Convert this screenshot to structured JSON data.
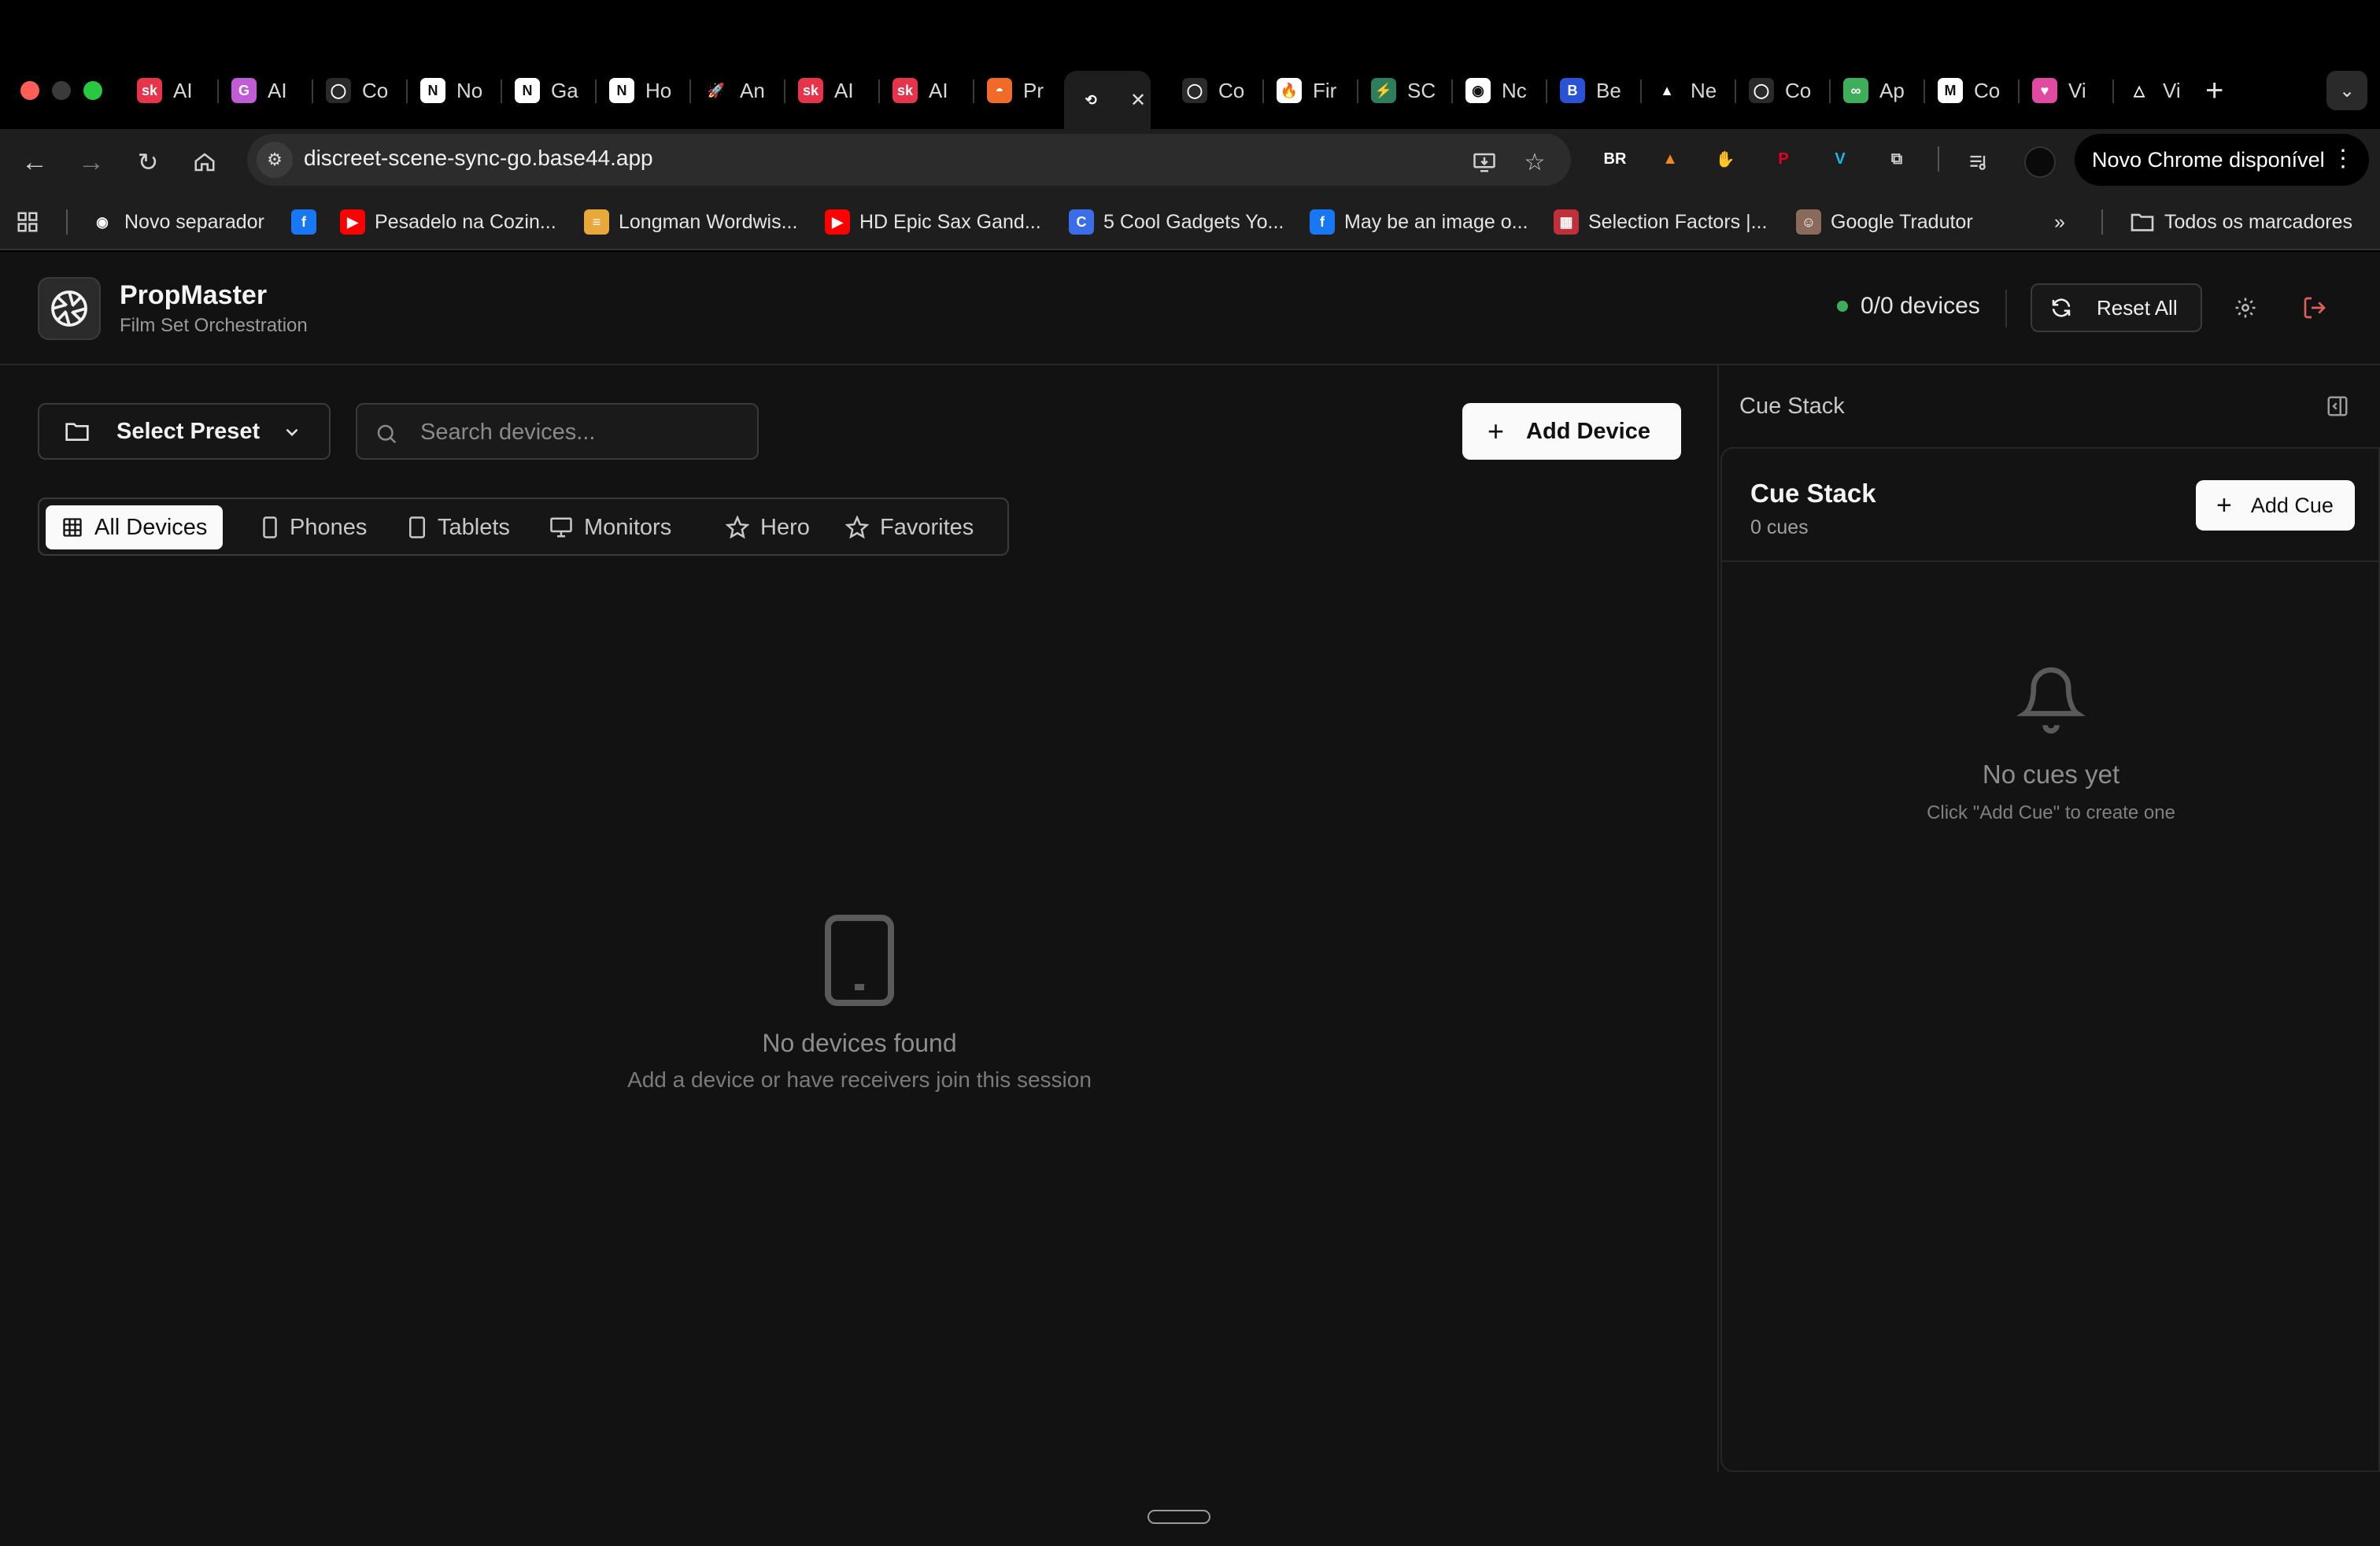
{
  "browser": {
    "tabs": [
      {
        "label": "AI",
        "favicon": "sk-logo-icon",
        "color": "#e8344a",
        "fav_text": "sk"
      },
      {
        "label": "AI",
        "favicon": "g-logo-icon",
        "color": "#c05cd6",
        "fav_text": "G"
      },
      {
        "label": "Co",
        "favicon": "github-icon",
        "color": "#2a2a2a",
        "fav_text": "◯"
      },
      {
        "label": "No",
        "favicon": "notion-icon",
        "color": "#ffffff",
        "fav_text": "N"
      },
      {
        "label": "Ga",
        "favicon": "notion-icon",
        "color": "#ffffff",
        "fav_text": "N"
      },
      {
        "label": "Ho",
        "favicon": "notion-icon",
        "color": "#ffffff",
        "fav_text": "N"
      },
      {
        "label": "An",
        "favicon": "rocket-icon",
        "color": "#000000",
        "fav_text": "🚀"
      },
      {
        "label": "AI",
        "favicon": "sk-logo-icon",
        "color": "#e8344a",
        "fav_text": "sk"
      },
      {
        "label": "AI",
        "favicon": "sk-logo-icon",
        "color": "#e8344a",
        "fav_text": "sk"
      },
      {
        "label": "Pr",
        "favicon": "sunset-icon",
        "color": "#f06a2a",
        "fav_text": "◓"
      },
      {
        "label": "",
        "favicon": "sync-icon",
        "color": "#1e1e1e",
        "fav_text": "⟲",
        "active": true
      },
      {
        "label": "Co",
        "favicon": "github-icon",
        "color": "#2a2a2a",
        "fav_text": "◯"
      },
      {
        "label": "Fir",
        "favicon": "fire-icon",
        "color": "#ffffff",
        "fav_text": "🔥"
      },
      {
        "label": "SC",
        "favicon": "bolt-icon",
        "color": "#2e7d5b",
        "fav_text": "⚡"
      },
      {
        "label": "Nc",
        "favicon": "chrome-icon",
        "color": "#ffffff",
        "fav_text": "◉"
      },
      {
        "label": "Be",
        "favicon": "be-icon",
        "color": "#2a52d8",
        "fav_text": "B"
      },
      {
        "label": "Ne",
        "favicon": "triangle-icon",
        "color": "#000000",
        "fav_text": "▲"
      },
      {
        "label": "Co",
        "favicon": "github-icon",
        "color": "#2a2a2a",
        "fav_text": "◯"
      },
      {
        "label": "Ap",
        "favicon": "infinity-icon",
        "color": "#3fae5a",
        "fav_text": "∞"
      },
      {
        "label": "Co",
        "favicon": "gmail-icon",
        "color": "#ffffff",
        "fav_text": "M"
      },
      {
        "label": "Vi",
        "favicon": "heart-icon",
        "color": "#e04aa0",
        "fav_text": "♥"
      },
      {
        "label": "Vi",
        "favicon": "warning-icon",
        "color": "#000000",
        "fav_text": "△"
      }
    ],
    "url": "discreet-scene-sync-go.base44.app",
    "update_label": "Novo Chrome disponível",
    "extensions": [
      {
        "icon": "br-icon",
        "text": "BR",
        "color": "#ffffff"
      },
      {
        "icon": "vlc-icon",
        "text": "▲",
        "color": "#f08a1c"
      },
      {
        "icon": "hand-icon",
        "text": "✋",
        "color": "#e03a3a"
      },
      {
        "icon": "pinterest-icon",
        "text": "P",
        "color": "#e60023"
      },
      {
        "icon": "vimeo-icon",
        "text": "V",
        "color": "#1ab7ea"
      },
      {
        "icon": "puzzle-icon",
        "text": "⧉",
        "color": "#d0d0d0"
      }
    ],
    "bookmarks": [
      {
        "label": "Novo separador",
        "icon": "globe-icon",
        "fav_text": "◉",
        "color": "#ffffff"
      },
      {
        "label": "",
        "icon": "facebook-icon",
        "fav_text": "f",
        "color": "#1877f2"
      },
      {
        "label": "Pesadelo na Cozin...",
        "icon": "youtube-icon",
        "fav_text": "▶",
        "color": "#ff0000"
      },
      {
        "label": "Longman Wordwis...",
        "icon": "book-icon",
        "fav_text": "≡",
        "color": "#e8a83a"
      },
      {
        "label": "HD Epic Sax Gand...",
        "icon": "youtube-icon",
        "fav_text": "▶",
        "color": "#ff0000"
      },
      {
        "label": "5 Cool Gadgets Yo...",
        "icon": "c-logo-icon",
        "fav_text": "C",
        "color": "#3a6ee8"
      },
      {
        "label": "May be an image o...",
        "icon": "facebook-icon",
        "fav_text": "f",
        "color": "#1877f2"
      },
      {
        "label": "Selection Factors |...",
        "icon": "grid-icon",
        "fav_text": "▦",
        "color": "#c0303a"
      },
      {
        "label": "Google Tradutor",
        "icon": "person-icon",
        "fav_text": "☺",
        "color": "#8a6a5a"
      }
    ],
    "all_bookmarks_label": "Todos os marcadores"
  },
  "app": {
    "name": "PropMaster",
    "subtitle": "Film Set Orchestration",
    "device_status": "0/0 devices",
    "reset_label": "Reset All",
    "preset_label": "Select Preset",
    "search_placeholder": "Search devices...",
    "add_device_label": "Add Device",
    "filter_tabs": [
      {
        "label": "All Devices",
        "icon": "grid-icon",
        "active": true
      },
      {
        "label": "Phones",
        "icon": "phone-icon"
      },
      {
        "label": "Tablets",
        "icon": "tablet-icon"
      },
      {
        "label": "Monitors",
        "icon": "monitor-icon"
      },
      {
        "label": "Hero",
        "icon": "star-icon"
      },
      {
        "label": "Favorites",
        "icon": "star-icon"
      }
    ],
    "empty_devices": {
      "title": "No devices found",
      "hint": "Add a device or have receivers join this session"
    },
    "cue_panel": {
      "panel_title": "Cue Stack",
      "title": "Cue Stack",
      "count": "0 cues",
      "add_label": "Add Cue",
      "empty_title": "No cues yet",
      "empty_hint": "Click \"Add Cue\" to create one"
    },
    "colors": {
      "status_dot": "#3fae5a",
      "logout": "#e0605a",
      "primary_button": "#fafafa"
    }
  }
}
